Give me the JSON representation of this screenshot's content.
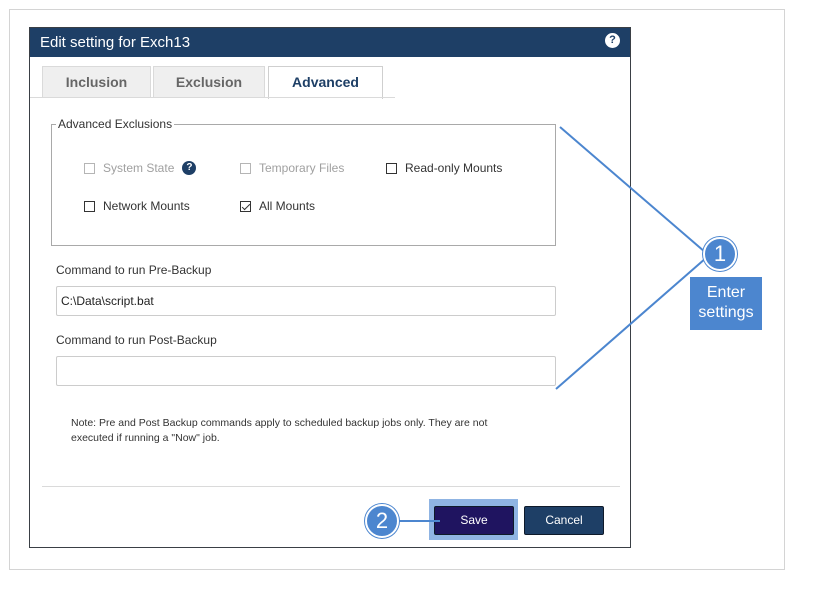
{
  "dialog": {
    "title": "Edit setting for Exch13",
    "help_glyph": "?"
  },
  "tabs": [
    {
      "label": "Inclusion",
      "active": false
    },
    {
      "label": "Exclusion",
      "active": false
    },
    {
      "label": "Advanced",
      "active": true
    }
  ],
  "advanced_exclusions": {
    "legend": "Advanced Exclusions",
    "help_glyph": "?",
    "options": {
      "system_state": {
        "label": "System State",
        "checked": false,
        "disabled": true
      },
      "temporary_files": {
        "label": "Temporary Files",
        "checked": false,
        "disabled": true
      },
      "readonly_mounts": {
        "label": "Read-only Mounts",
        "checked": false,
        "disabled": false
      },
      "network_mounts": {
        "label": "Network Mounts",
        "checked": false,
        "disabled": false
      },
      "all_mounts": {
        "label": "All Mounts",
        "checked": true,
        "disabled": false
      }
    }
  },
  "pre_backup": {
    "label": "Command to run Pre-Backup",
    "value": "C:\\Data\\script.bat"
  },
  "post_backup": {
    "label": "Command to run Post-Backup",
    "value": ""
  },
  "note": {
    "line1": "Note: Pre and Post Backup commands apply to scheduled backup jobs only. They are not",
    "line2": "executed if running a \"Now\" job."
  },
  "buttons": {
    "save": "Save",
    "cancel": "Cancel"
  },
  "callouts": {
    "step1_number": "1",
    "step1_line1": "Enter",
    "step1_line2": "settings",
    "step2_number": "2"
  },
  "colors": {
    "titlebar": "#1e3f66",
    "save_button": "#1f1460",
    "cancel_button": "#1e3f66",
    "callout": "#4c86cf",
    "save_highlight": "#8fb4e3"
  }
}
